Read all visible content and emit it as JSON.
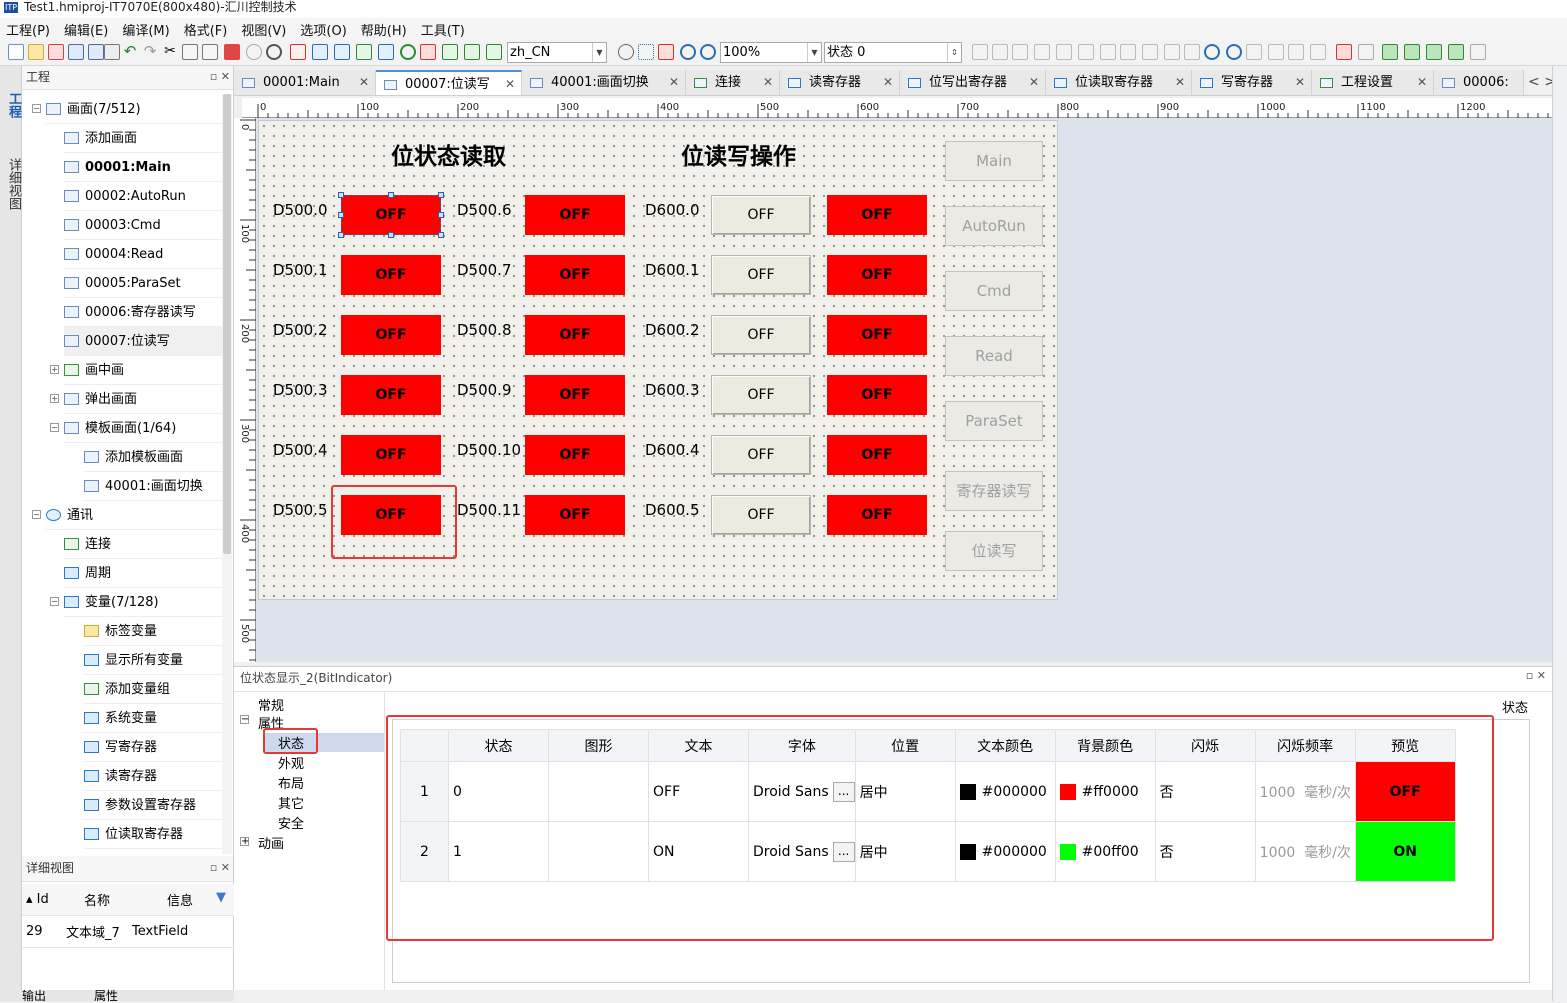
{
  "titlebar": {
    "icon": "ITP",
    "text": "Test1.hmiproj-IT7070E(800x480)-汇川控制技术"
  },
  "menu": [
    "工程(P)",
    "编辑(E)",
    "编译(M)",
    "格式(F)",
    "视图(V)",
    "选项(O)",
    "帮助(H)",
    "工具(T)"
  ],
  "toolbar": {
    "language": "zh_CN",
    "zoom": "100%",
    "state": "状态 0"
  },
  "left_tabs": {
    "project": "工程",
    "detail": "详细视图"
  },
  "project_panel": {
    "title": "工程",
    "items": [
      {
        "label": "画面(7/512)"
      },
      {
        "label": "添加画面"
      },
      {
        "label": "00001:Main"
      },
      {
        "label": "00002:AutoRun"
      },
      {
        "label": "00003:Cmd"
      },
      {
        "label": "00004:Read"
      },
      {
        "label": "00005:ParaSet"
      },
      {
        "label": "00006:寄存器读写"
      },
      {
        "label": "00007:位读写"
      },
      {
        "label": "画中画"
      },
      {
        "label": "弹出画面"
      },
      {
        "label": "模板画面(1/64)"
      },
      {
        "label": "添加模板画面"
      },
      {
        "label": "40001:画面切换"
      },
      {
        "label": "通讯"
      },
      {
        "label": "连接"
      },
      {
        "label": "周期"
      },
      {
        "label": "变量(7/128)"
      },
      {
        "label": "标签变量"
      },
      {
        "label": "显示所有变量"
      },
      {
        "label": "添加变量组"
      },
      {
        "label": "系统变量"
      },
      {
        "label": "写寄存器"
      },
      {
        "label": "读寄存器"
      },
      {
        "label": "参数设置寄存器"
      },
      {
        "label": "位读取寄存器"
      }
    ]
  },
  "detail_panel": {
    "title": "详细视图",
    "columns": [
      "Id",
      "名称",
      "信息"
    ],
    "rows": [
      {
        "id": "29",
        "name": "文本域_7",
        "info": "TextField"
      }
    ]
  },
  "bottom_tabs": [
    "输出",
    "属性"
  ],
  "doc_tabs": [
    "00001:Main",
    "00007:位读写",
    "40001:画面切换",
    "连接",
    "读寄存器",
    "位写出寄存器",
    "位读取寄存器",
    "写寄存器",
    "工程设置",
    "00006:"
  ],
  "ruler": {
    "h": [
      "0",
      "100",
      "200",
      "300",
      "400",
      "500",
      "600",
      "700",
      "800",
      "900",
      "1000",
      "1100",
      "1200"
    ],
    "v": [
      "0",
      "100",
      "200",
      "300",
      "400",
      "500"
    ]
  },
  "screen": {
    "heading_read": "位状态读取",
    "heading_write": "位读写操作",
    "col1_labels": [
      "D500.0",
      "D500.1",
      "D500.2",
      "D500.3",
      "D500.4",
      "D500.5"
    ],
    "col2_labels": [
      "D500.6",
      "D500.7",
      "D500.8",
      "D500.9",
      "D500.10",
      "D500.11"
    ],
    "col3_labels": [
      "D600.0",
      "D600.1",
      "D600.2",
      "D600.3",
      "D600.4",
      "D600.5"
    ],
    "indicator_text": "OFF",
    "write_button_text": "OFF",
    "nav_buttons": [
      "Main",
      "AutoRun",
      "Cmd",
      "Read",
      "ParaSet",
      "寄存器读写",
      "位读写"
    ]
  },
  "properties": {
    "title": "位状态显示_2(BitIndicator)",
    "right_label": "状态",
    "tree": {
      "general": "常规",
      "attributes": "属性",
      "state": "状态",
      "appearance": "外观",
      "layout": "布局",
      "other": "其它",
      "security": "安全",
      "animation": "动画"
    },
    "columns": [
      "状态",
      "图形",
      "文本",
      "字体",
      "位置",
      "文本颜色",
      "背景颜色",
      "闪烁",
      "闪烁频率",
      "预览"
    ],
    "rows": [
      {
        "index": "1",
        "state": "0",
        "graphic": "",
        "text": "OFF",
        "font": "Droid Sans",
        "position": "居中",
        "text_color": "#000000",
        "bg_color": "#ff0000",
        "blink": "否",
        "blink_freq": "1000",
        "blink_unit": "毫秒/次",
        "preview": "OFF"
      },
      {
        "index": "2",
        "state": "1",
        "graphic": "",
        "text": "ON",
        "font": "Droid Sans",
        "position": "居中",
        "text_color": "#000000",
        "bg_color": "#00ff00",
        "blink": "否",
        "blink_freq": "1000",
        "blink_unit": "毫秒/次",
        "preview": "ON"
      }
    ],
    "font_button": "..."
  },
  "colors": {
    "off": "#ff0000",
    "on": "#00ff00",
    "highlight": "#e53935",
    "accent": "#4a90d9"
  }
}
